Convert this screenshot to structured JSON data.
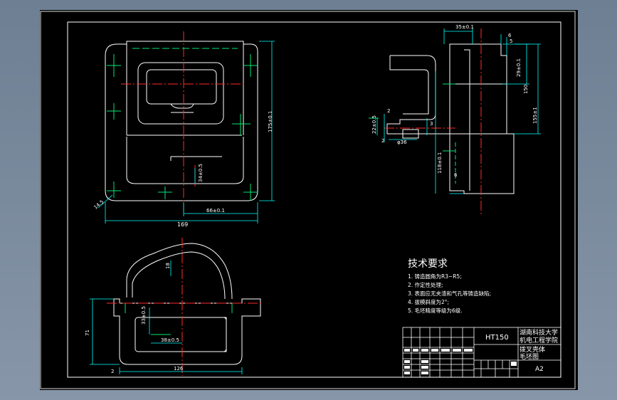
{
  "colors": {
    "chrome_top": "#6e7f93",
    "chrome_bottom": "#8796a8",
    "paper": "#000000",
    "outline": "#ffffff",
    "center_line": "#ff2a2a",
    "hidden_line": "#00e676",
    "dimension": "#00ffff",
    "text": "#ffffff"
  },
  "dimensions": {
    "d_169": "169",
    "d_66": "66±0.1",
    "d_145": "14.5",
    "d_175": "175±0.1",
    "d_34": "34±0.5",
    "d_355": "35±0.1",
    "d_6": "6",
    "d_5": "5",
    "d_29": "29±0.1",
    "d_150": "150",
    "d_155": "155±1",
    "d_118": "118±0.1",
    "d_22": "22±0.5",
    "d_2a": "2",
    "d_2b": "2",
    "d_36": "φ36",
    "d_3": "3",
    "d_6b": "6",
    "d_18": "18",
    "d_71": "71",
    "d_2c": "2",
    "d_126": "126",
    "d_33": "33±0.5",
    "d_38": "38±0.5"
  },
  "notes": {
    "title": "技术要求",
    "items": [
      "1. 铸造圆角为R3~R5;",
      "2. 作定性处理;",
      "3. 表面应无夹渣和气孔等铸造缺陷;",
      "4. 拔模斜度为2°;",
      "5. 毛坯精度等级为6级."
    ]
  },
  "title_block": {
    "material": "HT150",
    "school_line1": "湖南科技大学",
    "school_line2": "机电工程学院",
    "part_name_line1": "拨叉壳体",
    "part_name_line2": "毛坯图",
    "sheet": "A2"
  }
}
